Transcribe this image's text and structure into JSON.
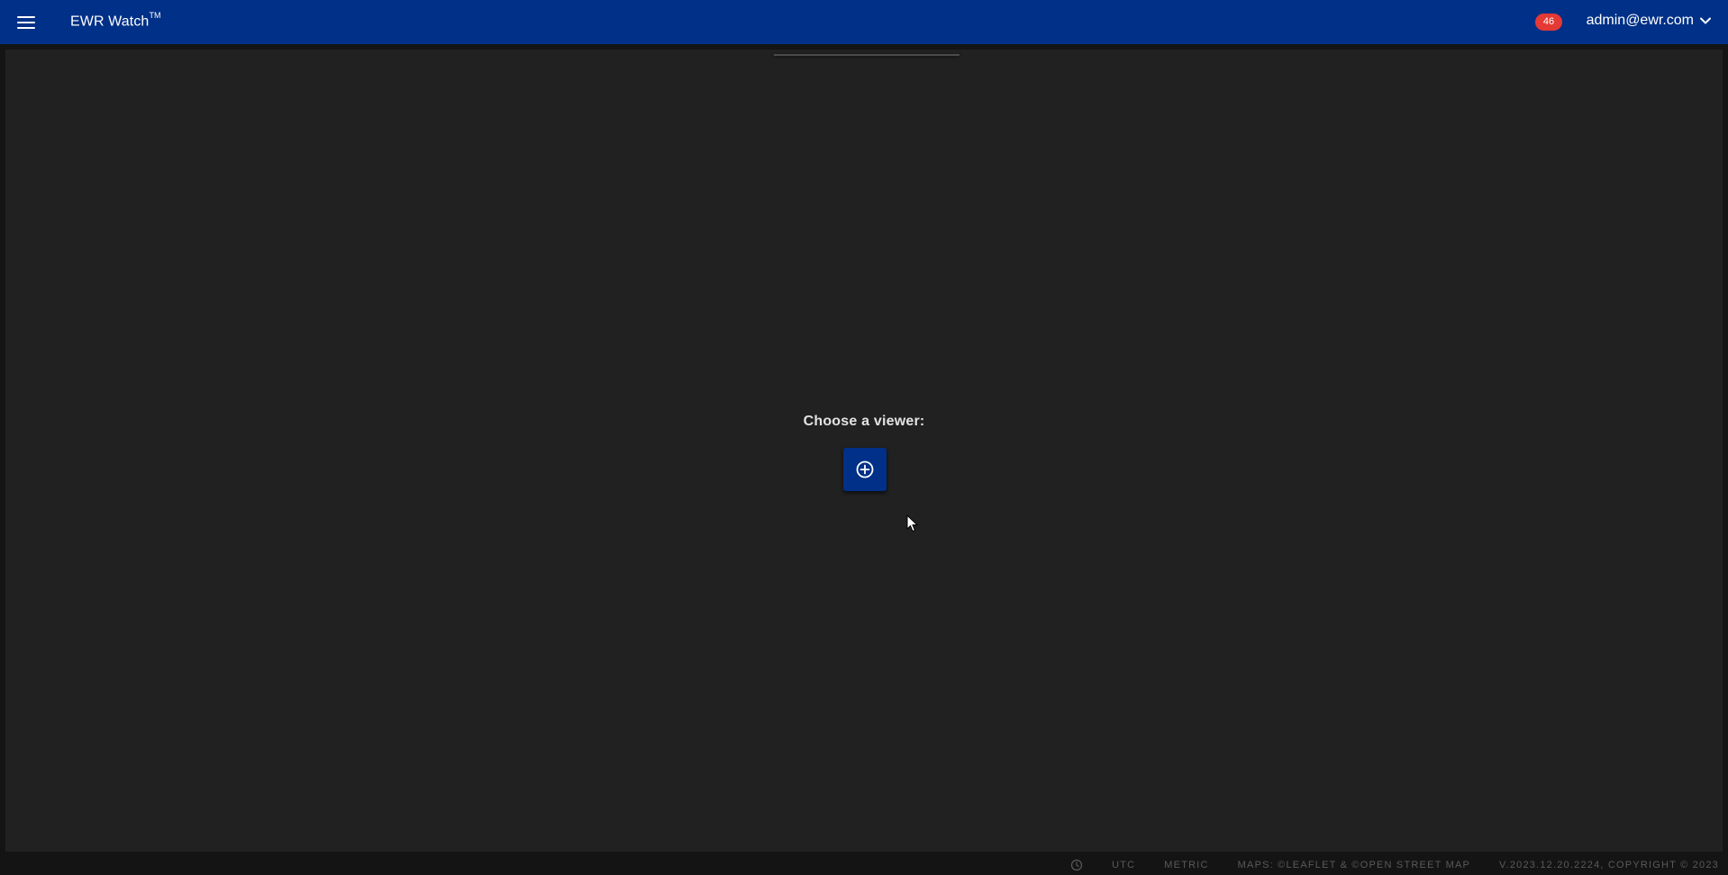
{
  "header": {
    "app_title": "EWR Watch",
    "trademark": "TM",
    "notification_count": "46",
    "user_email": "admin@ewr.com"
  },
  "main": {
    "chooser_label": "Choose a viewer:"
  },
  "footer": {
    "timezone": "UTC",
    "units": "METRIC",
    "maps_credit": "MAPS: ©LEAFLET & ©OPEN STREET MAP",
    "version": "V.2023.12.20.2224, COPYRIGHT © 2023"
  },
  "colors": {
    "topbar_bg": "#003087",
    "badge_bg": "#e53935",
    "panel_bg": "#212121",
    "page_bg": "#141414"
  },
  "icons": {
    "menu": "hamburger-icon",
    "user_dropdown": "chevron-down-icon",
    "add_viewer": "plus-circle-icon",
    "clock": "clock-icon"
  }
}
